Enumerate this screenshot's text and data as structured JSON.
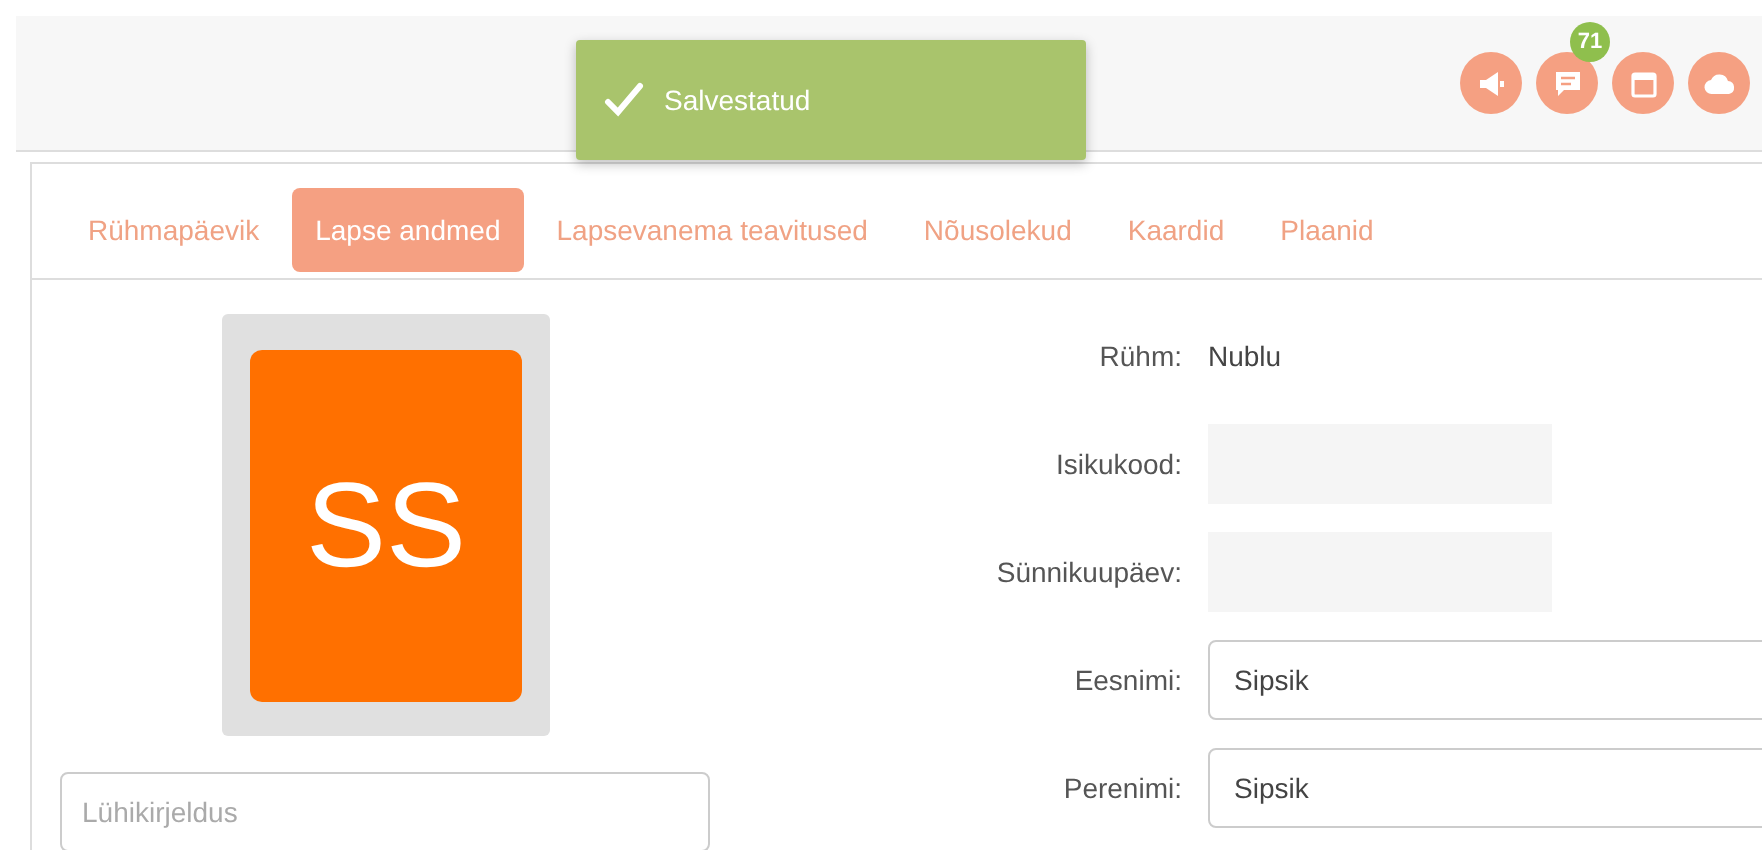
{
  "toast": {
    "kind": "success",
    "message": "Salvestatud"
  },
  "header_icons": [
    {
      "kind": "megaphone"
    },
    {
      "kind": "chat",
      "badge": "71"
    },
    {
      "kind": "calendar"
    },
    {
      "kind": "cloud"
    }
  ],
  "tabs": [
    {
      "label": "Rühmapäevik",
      "selected": false
    },
    {
      "label": "Lapse andmed",
      "selected": true
    },
    {
      "label": "Lapsevanema teavitused",
      "selected": false
    },
    {
      "label": "Nõusolekud",
      "selected": false
    },
    {
      "label": "Kaardid",
      "selected": false
    },
    {
      "label": "Plaanid",
      "selected": false
    }
  ],
  "avatar": {
    "initials": "SS"
  },
  "description_field": {
    "placeholder": "Lühikirjeldus"
  },
  "form": [
    {
      "label": "Rühm:",
      "kind": "text",
      "value": "Nublu"
    },
    {
      "label": "Isikukood:",
      "kind": "field",
      "disabled": true
    },
    {
      "label": "Sünnikuupäev:",
      "kind": "field",
      "disabled": true
    },
    {
      "label": "Eesnimi:",
      "kind": "field",
      "disabled": false,
      "value": "Sipsik"
    },
    {
      "label": "Perenimi:",
      "kind": "field",
      "disabled": false,
      "value": "Sipsik"
    }
  ]
}
